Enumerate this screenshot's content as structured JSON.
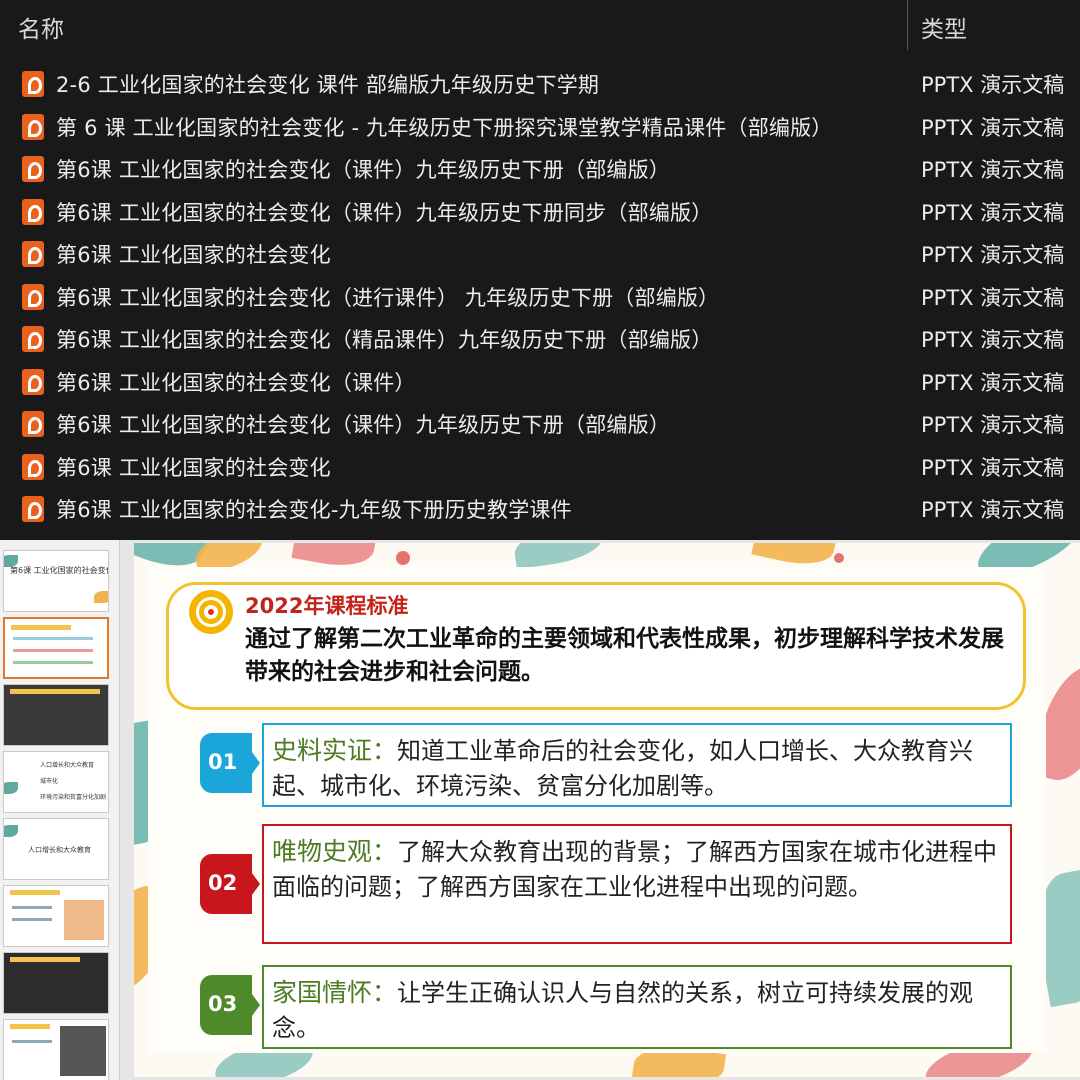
{
  "explorer": {
    "columns": {
      "name": "名称",
      "type": "类型"
    },
    "files": [
      {
        "name": "2-6 工业化国家的社会变化 课件 部编版九年级历史下学期",
        "type": "PPTX 演示文稿"
      },
      {
        "name": "第 6 课  工业化国家的社会变化 - 九年级历史下册探究课堂教学精品课件（部编版）",
        "type": "PPTX 演示文稿"
      },
      {
        "name": "第6课  工业化国家的社会变化（课件）九年级历史下册（部编版）",
        "type": "PPTX 演示文稿"
      },
      {
        "name": "第6课  工业化国家的社会变化（课件）九年级历史下册同步（部编版）",
        "type": "PPTX 演示文稿"
      },
      {
        "name": "第6课  工业化国家的社会变化",
        "type": "PPTX 演示文稿"
      },
      {
        "name": "第6课 工业化国家的社会变化（进行课件） 九年级历史下册（部编版）",
        "type": "PPTX 演示文稿"
      },
      {
        "name": "第6课 工业化国家的社会变化（精品课件）九年级历史下册（部编版）",
        "type": "PPTX 演示文稿"
      },
      {
        "name": "第6课 工业化国家的社会变化（课件）",
        "type": "PPTX 演示文稿"
      },
      {
        "name": "第6课 工业化国家的社会变化（课件）九年级历史下册（部编版）",
        "type": "PPTX 演示文稿"
      },
      {
        "name": "第6课 工业化国家的社会变化",
        "type": "PPTX 演示文稿"
      },
      {
        "name": "第6课 工业化国家的社会变化-九年级下册历史教学课件",
        "type": "PPTX 演示文稿"
      }
    ]
  },
  "thumbnails": {
    "slide1_title": "第6课 工业化国家的社会变化",
    "slide4_items": [
      "人口增长和大众教育",
      "城市化",
      "环境污染和贫富分化加剧"
    ],
    "slide5_title": "人口增长和大众教育"
  },
  "slide": {
    "standard_title": "2022年课程标准",
    "standard_text": "通过了解第二次工业革命的主要领域和代表性成果，初步理解科学技术发展带来的社会进步和社会问题。",
    "items": [
      {
        "num": "01",
        "label": "史料实证：",
        "text": "知道工业革命后的社会变化，如人口增长、大众教育兴起、城市化、环境污染、贫富分化加剧等。",
        "color": "#1aa6d9"
      },
      {
        "num": "02",
        "label": "唯物史观：",
        "text": "了解大众教育出现的背景；了解西方国家在城市化进程中面临的问题；了解西方国家在工业化进程中出现的问题。",
        "color": "#c8161d"
      },
      {
        "num": "03",
        "label": "家国情怀：",
        "text": "让学生正确认识人与自然的关系，树立可持续发展的观念。",
        "color": "#4e8a2a"
      }
    ]
  },
  "colors": {
    "accent_orange": "#e8611d",
    "gold": "#f2c232"
  }
}
